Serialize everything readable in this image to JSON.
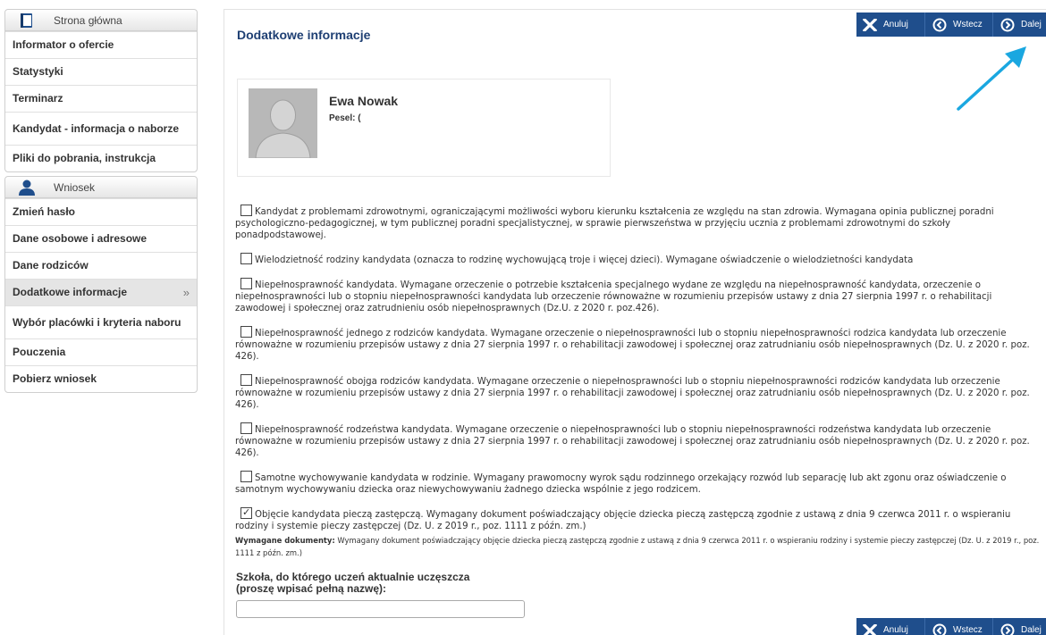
{
  "sidebar": {
    "home": {
      "label": "Strona główna",
      "icon": "book-icon"
    },
    "top_items": [
      {
        "label": "Informator o ofercie"
      },
      {
        "label": "Statystyki"
      },
      {
        "label": "Terminarz"
      },
      {
        "label": "Kandydat - informacja o naborze"
      },
      {
        "label": "Pliki do pobrania, instrukcja"
      }
    ],
    "section": {
      "label": "Wniosek",
      "icon": "user-icon"
    },
    "items": [
      {
        "label": "Zmień hasło"
      },
      {
        "label": "Dane osobowe i adresowe"
      },
      {
        "label": "Dane rodziców"
      },
      {
        "label": "Dodatkowe informacje",
        "active": true,
        "arrow": "»"
      },
      {
        "label": "Wybór placówki i kryteria naboru"
      },
      {
        "label": "Pouczenia"
      },
      {
        "label": "Pobierz wniosek"
      }
    ]
  },
  "main": {
    "title": "Dodatkowe informacje",
    "toolbar": {
      "cancel": "Anuluj",
      "back": "Wstecz",
      "next": "Dalej"
    },
    "profile": {
      "name": "Ewa Nowak",
      "pesel_label": "Pesel:",
      "pesel_value": "("
    },
    "options": [
      {
        "checked": false,
        "text": "Kandydat z problemami zdrowotnymi, ograniczającymi możliwości wyboru kierunku kształcenia ze względu na stan zdrowia. Wymagana opinia publicznej poradni psychologiczno-pedagogicznej, w tym publicznej poradni specjalistycznej, w sprawie pierwszeństwa w przyjęciu ucznia z problemami zdrowotnymi do szkoły ponadpodstawowej."
      },
      {
        "checked": false,
        "text": "Wielodzietność rodziny kandydata (oznacza to rodzinę wychowującą troje i więcej dzieci). Wymagane oświadczenie o wielodzietności kandydata"
      },
      {
        "checked": false,
        "text": "Niepełnosprawność kandydata. Wymagane orzeczenie o potrzebie kształcenia specjalnego wydane ze względu na niepełnosprawność kandydata, orzeczenie o niepełnosprawności lub o stopniu niepełnosprawności kandydata lub orzeczenie równoważne w rozumieniu przepisów ustawy z dnia 27 sierpnia 1997 r. o rehabilitacji zawodowej i społecznej oraz zatrudnieniu osób niepełnosprawnych (Dz.U. z 2020 r. poz.426)."
      },
      {
        "checked": false,
        "text": "Niepełnosprawność jednego z rodziców kandydata. Wymagane orzeczenie o niepełnosprawności lub o stopniu niepełnosprawności rodzica kandydata lub orzeczenie równoważne w rozumieniu przepisów ustawy z dnia 27 sierpnia 1997 r. o rehabilitacji zawodowej i społecznej oraz zatrudnianiu osób niepełnosprawnych (Dz. U. z 2020 r. poz. 426)."
      },
      {
        "checked": false,
        "text": "Niepełnosprawność obojga rodziców kandydata. Wymagane orzeczenie o niepełnosprawności lub o stopniu niepełnosprawności rodziców kandydata lub orzeczenie równoważne w rozumieniu przepisów ustawy z dnia 27 sierpnia 1997 r. o rehabilitacji zawodowej i społecznej oraz zatrudnianiu osób niepełnosprawnych (Dz. U. z 2020 r. poz. 426)."
      },
      {
        "checked": false,
        "text": "Niepełnosprawność rodzeństwa kandydata. Wymagane orzeczenie o niepełnosprawności lub o stopniu niepełnosprawności rodzeństwa kandydata lub orzeczenie równoważne w rozumieniu przepisów ustawy z dnia 27 sierpnia 1997 r. o rehabilitacji zawodowej i społecznej oraz zatrudnianiu osób niepełnosprawnych (Dz. U. z 2020 r. poz. 426)."
      },
      {
        "checked": false,
        "text": "Samotne wychowywanie kandydata w rodzinie. Wymagany prawomocny wyrok sądu rodzinnego orzekający rozwód lub separację lub akt zgonu oraz oświadczenie o samotnym wychowywaniu dziecka oraz niewychowywaniu żadnego dziecka wspólnie z jego rodzicem."
      },
      {
        "checked": true,
        "text": "Objęcie kandydata pieczą zastępczą. Wymagany dokument poświadczający objęcie dziecka pieczą zastępczą zgodnie z ustawą z dnia 9 czerwca 2011 r. o wspieraniu rodziny i systemie pieczy zastępczej (Dz. U. z 2019 r., poz. 1111 z późn. zm.)"
      }
    ],
    "required_docs": {
      "label": "Wymagane dokumenty:",
      "text": "Wymagany dokument poświadczający objęcie dziecka pieczą zastępczą zgodnie z ustawą z dnia 9 czerwca 2011 r. o wspieraniu rodziny i systemie pieczy zastępczej (Dz. U. z 2019 r., poz. 1111 z późn. zm.)"
    },
    "school": {
      "label_line1": "Szkoła, do którego uczeń aktualnie uczęszcza",
      "label_line2": "(proszę wpisać pełną nazwę):",
      "value": ""
    }
  },
  "colors": {
    "toolbar": "#1f4e8c",
    "title": "#1e3f73",
    "pointer_arrow": "#1aa7e0"
  }
}
